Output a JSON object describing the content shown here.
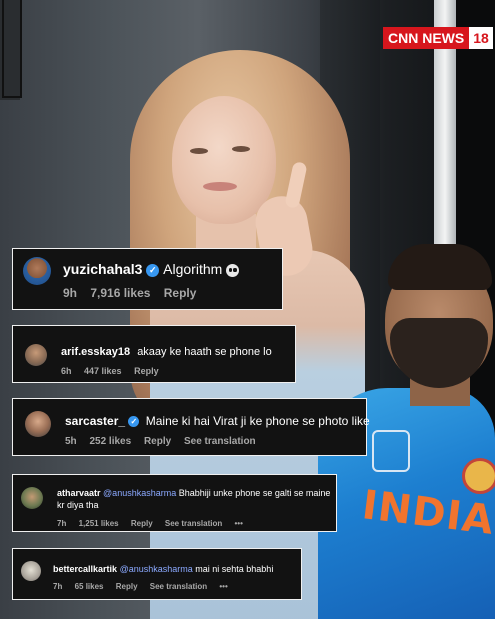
{
  "brand": {
    "logo_main": "CNN NEWS",
    "logo_number": "18"
  },
  "comments": [
    {
      "username": "yuzichahal3",
      "verified": true,
      "text": "Algorithm",
      "emoji": "skull-icon",
      "time": "9h",
      "likes": "7,916 likes",
      "reply": "Reply"
    },
    {
      "username": "arif.esskay18",
      "verified": false,
      "text": "akaay ke haath se phone lo",
      "time": "6h",
      "likes": "447 likes",
      "reply": "Reply"
    },
    {
      "username": "sarcaster_",
      "verified": true,
      "text": "Maine ki hai Virat ji ke phone se photo like",
      "time": "5h",
      "likes": "252 likes",
      "reply": "Reply",
      "translation": "See translation"
    },
    {
      "username": "atharvaatr",
      "verified": false,
      "mention": "@anushkasharma",
      "text": "Bhabhiji unke phone se galti se maine kr diya tha",
      "time": "7h",
      "likes": "1,251 likes",
      "reply": "Reply",
      "translation": "See translation",
      "more": "•••"
    },
    {
      "username": "bettercallkartik",
      "verified": false,
      "mention": "@anushkasharma",
      "text": "mai ni sehta bhabhi",
      "time": "7h",
      "likes": "65 likes",
      "reply": "Reply",
      "translation": "See translation",
      "more": "•••"
    }
  ],
  "jersey": {
    "text": "INDIA"
  },
  "colors": {
    "card_bg": "#121212",
    "verified": "#3797f0",
    "mention": "#8ba9ff",
    "brand_red": "#d7161d",
    "jersey_blue": "#1d7fd0",
    "jersey_text": "#f0742e"
  }
}
